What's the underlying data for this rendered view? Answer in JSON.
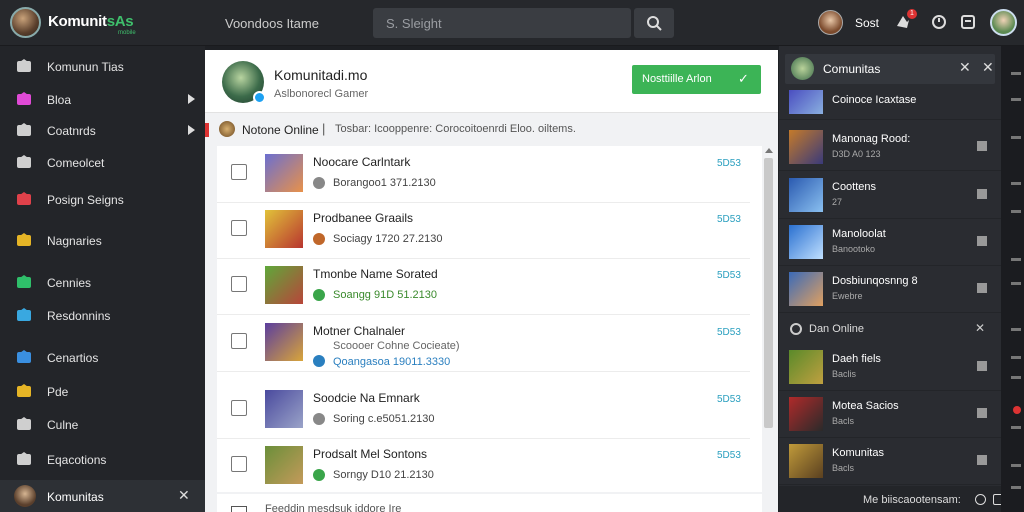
{
  "app": {
    "logo_text": "Komunit",
    "logo_accent": "sAs",
    "logo_sub": "mobile",
    "page_title": "Voondoos Itame"
  },
  "search": {
    "placeholder": "S. Sleight"
  },
  "top_user": {
    "name": "Sost",
    "notifications": "1"
  },
  "sidebar": {
    "items": [
      {
        "label": "Komunun Tias",
        "icon": "home-icon",
        "color": "#cfcfcf",
        "arrow": false
      },
      {
        "label": "Bloa",
        "icon": "puzzle-icon",
        "color": "#e04ad6",
        "arrow": true
      },
      {
        "label": "Coatnrds",
        "icon": "castle-icon",
        "color": "#cfcfcf",
        "arrow": true
      },
      {
        "label": "Comeolcet",
        "icon": "chat-icon",
        "color": "#cfcfcf",
        "arrow": false
      },
      {
        "label": "Posign Seigns",
        "icon": "rocket-icon",
        "color": "#e0414a",
        "arrow": false
      },
      {
        "label": "Nagnaries",
        "icon": "card-icon",
        "color": "#e6b526",
        "arrow": false
      },
      {
        "label": "Cennies",
        "icon": "flag-icon",
        "color": "#2fbf6a",
        "arrow": false
      },
      {
        "label": "Resdonnins",
        "icon": "globe-icon",
        "color": "#39a8e0",
        "arrow": false
      },
      {
        "label": "Cenartios",
        "icon": "chart-icon",
        "color": "#3a8fe0",
        "arrow": false
      },
      {
        "label": "Pde",
        "icon": "coin-icon",
        "color": "#e6b526",
        "arrow": false
      },
      {
        "label": "Culne",
        "icon": "grid-icon",
        "color": "#cfcfcf",
        "arrow": false
      },
      {
        "label": "Eqacotions",
        "icon": "home-icon",
        "color": "#cfcfcf",
        "arrow": false
      }
    ],
    "bottom": {
      "label": "Komunitas"
    }
  },
  "main": {
    "title": "Komunitadi.mo",
    "subtitle": "Aslbonorecl Gamer",
    "join_label": "Nosttiille Arlon",
    "online_label": "Notone Online",
    "online_text": "Tosbar: Icooppenre: Corocoitoenrdi Eloo. oiltems.",
    "rows": [
      {
        "title": "Noocare Carlntark",
        "meta": "Borangoo1 371.2130",
        "count": "5D53",
        "thumb": [
          "#6b6fd0",
          "#e8914a"
        ],
        "meta_color": "#444",
        "meta_icon": "#888"
      },
      {
        "title": "Prodbanee Graails",
        "meta": "Sociagy 1720 27.2130",
        "count": "5D53",
        "thumb": [
          "#e1c23a",
          "#b8352f"
        ],
        "meta_color": "#444",
        "meta_icon": "#c0672a"
      },
      {
        "title": "Tmonbe Name Sorated",
        "meta": "Soangg 91D 51.2130",
        "count": "5D53",
        "thumb": [
          "#5fa83a",
          "#b8453a"
        ],
        "meta_color": "#3a8a2c",
        "meta_icon": "#3aa54a"
      },
      {
        "title": "Motner Chalnaler",
        "meta": "Qoangasoa 19011.3330",
        "count": "5D53",
        "thumb": [
          "#5b3e9e",
          "#d9a53a"
        ],
        "meta_color": "#2a7fbf",
        "meta_icon": "#2a7fbf",
        "subtitle": "Scoooer Cohne Cocieate)"
      },
      {
        "title": "Soodcie Na Emnark",
        "meta": "Soring c.e5051.2130",
        "count": "5D53",
        "thumb": [
          "#4a4a9e",
          "#9aa3c8"
        ],
        "meta_color": "#444",
        "meta_icon": "#888"
      },
      {
        "title": "Prodsalt Mel Sontons",
        "meta": "Sorngy D10 21.2130",
        "count": "5D53",
        "thumb": [
          "#6b8f3a",
          "#c49a5a"
        ],
        "meta_color": "#444",
        "meta_icon": "#3aa54a"
      }
    ],
    "bottom_text": "Feeddin mesdsuk iddore Ire"
  },
  "rpanel": {
    "header": "Comunitas",
    "items": [
      {
        "title": "Coinoce Icaxtase",
        "sub": "",
        "thumb": [
          "#4a4ec0",
          "#8ab0e0"
        ]
      },
      {
        "title": "Manonag Rood:",
        "sub": "D3D A0 123",
        "thumb": [
          "#c47a2a",
          "#3a3a7a"
        ]
      },
      {
        "title": "Coottens",
        "sub": "27",
        "thumb": [
          "#2a5ab0",
          "#8ac0f0"
        ]
      },
      {
        "title": "Manoloolat",
        "sub": "Banootoko",
        "thumb": [
          "#2a70d0",
          "#c0e0ff"
        ]
      },
      {
        "title": "Dosbiunqosnng 8",
        "sub": "Ewebre",
        "thumb": [
          "#3a6ab8",
          "#e0a060"
        ]
      }
    ],
    "section_label": "Dan Online",
    "online_items": [
      {
        "title": "Daeh fiels",
        "sub": "Baclis",
        "thumb": [
          "#5a8a2a",
          "#c0a040"
        ]
      },
      {
        "title": "Motea Sacios",
        "sub": "Bacls",
        "thumb": [
          "#b02a2a",
          "#2a2a2a"
        ]
      },
      {
        "title": "Komunitas",
        "sub": "Bacls",
        "thumb": [
          "#c09a3a",
          "#5a4020"
        ]
      }
    ],
    "footer": "Me biiscaootensam:"
  }
}
